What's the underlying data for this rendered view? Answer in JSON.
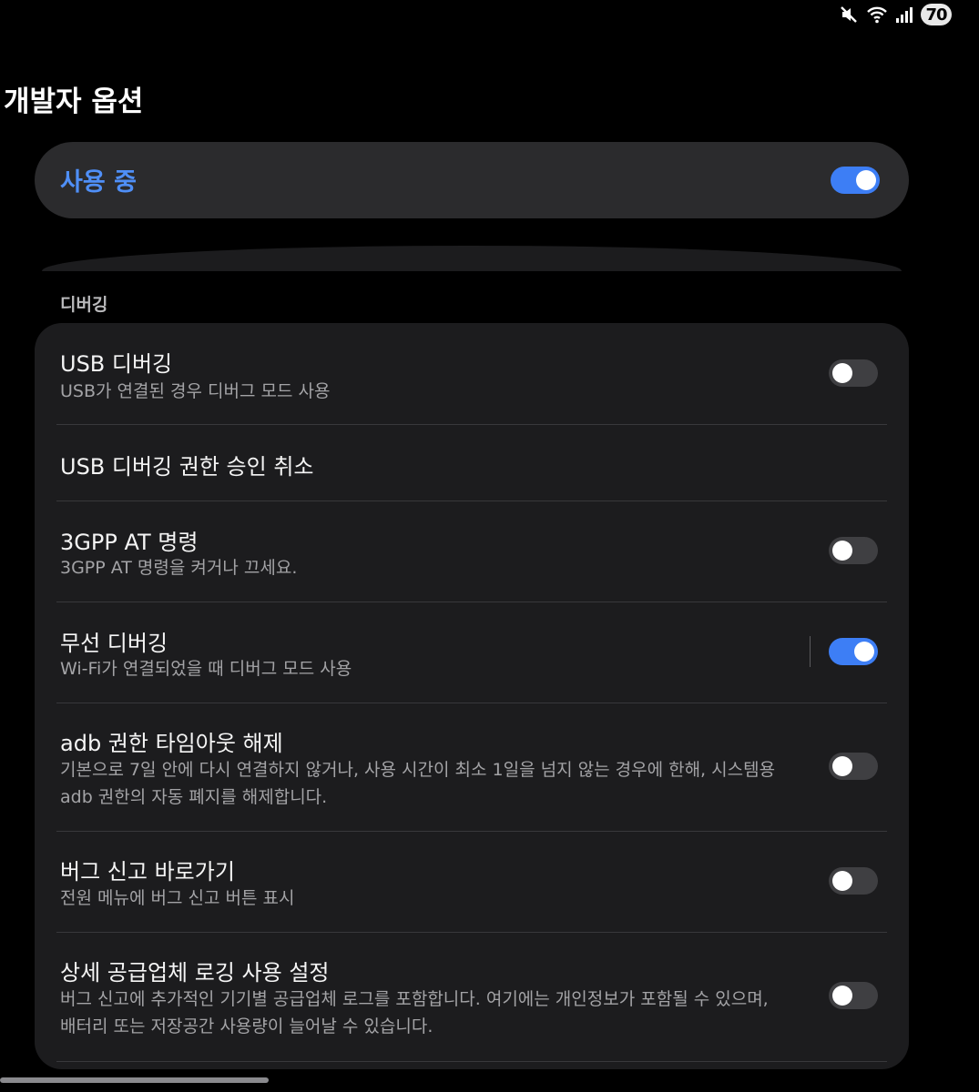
{
  "status_bar": {
    "icons": [
      "mute-icon",
      "wifi-icon",
      "signal-icon"
    ],
    "battery": "70"
  },
  "page": {
    "title": "개발자 옵션"
  },
  "master": {
    "label": "사용 중",
    "enabled": true
  },
  "section": {
    "header": "디버깅"
  },
  "items": [
    {
      "title": "USB 디버깅",
      "desc": "USB가 연결된 경우 디버그 모드 사용",
      "toggle": false
    },
    {
      "title": "USB 디버깅 권한 승인 취소"
    },
    {
      "title": "3GPP AT 명령",
      "desc": "3GPP AT 명령을 켜거나 끄세요.",
      "toggle": false
    },
    {
      "title": "무선 디버깅",
      "desc": "Wi-Fi가 연결되었을 때 디버그 모드 사용",
      "toggle": true
    },
    {
      "title": "adb 권한 타임아웃 해제",
      "desc": "기본으로 7일 안에 다시 연결하지 않거나, 사용 시간이 최소 1일을 넘지 않는 경우에 한해, 시스템용 adb 권한의 자동 폐지를 해제합니다.",
      "toggle": false
    },
    {
      "title": "버그 신고 바로가기",
      "desc": "전원 메뉴에 버그 신고 버튼 표시",
      "toggle": false
    },
    {
      "title": "상세 공급업체 로깅 사용 설정",
      "desc": "버그 신고에 추가적인 기기별 공급업체 로그를 포함합니다. 여기에는 개인정보가 포함될 수 있으며, 배터리 또는 저장공간 사용량이 늘어날 수 있습니다.",
      "toggle": false
    }
  ],
  "colors": {
    "accent": "#3d7ef5",
    "accent_text": "#4f8ff7",
    "card": "#1c1c1e",
    "background": "#000000"
  }
}
